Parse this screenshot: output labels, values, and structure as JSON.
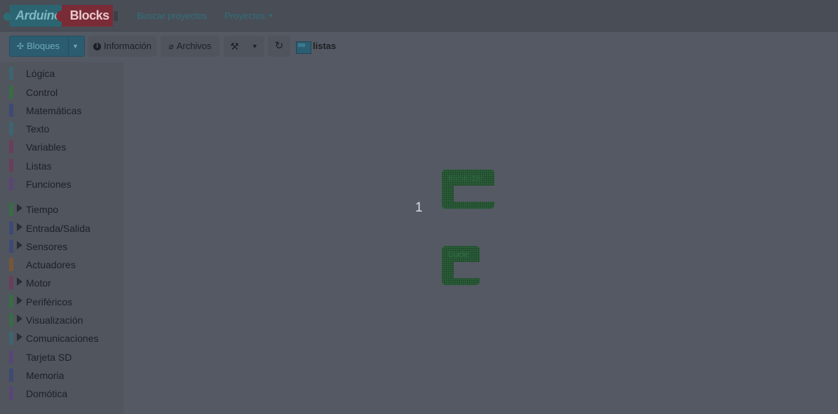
{
  "app": {
    "logo_left": "Arduino",
    "logo_right": "Blocks"
  },
  "nav": {
    "search_projects": "Buscar proyectos",
    "projects": "Proyectos"
  },
  "toolbar": {
    "blocks": "Bloques",
    "info": "Información",
    "files": "Archivos",
    "project_name": "listas"
  },
  "sidebar": {
    "categories": [
      {
        "label": "Lógica",
        "color": "#3d6470",
        "expandable": false
      },
      {
        "label": "Control",
        "color": "#386b46",
        "expandable": false
      },
      {
        "label": "Matemáticas",
        "color": "#3f4a74",
        "expandable": false
      },
      {
        "label": "Texto",
        "color": "#3d6470",
        "expandable": false
      },
      {
        "label": "Variables",
        "color": "#6b3d5e",
        "expandable": false
      },
      {
        "label": "Listas",
        "color": "#6b3d5e",
        "expandable": false
      },
      {
        "label": "Funciones",
        "color": "#5a4577",
        "expandable": false
      },
      {
        "label": "Tiempo",
        "color": "#386b46",
        "expandable": true
      },
      {
        "label": "Entrada/Salida",
        "color": "#3f4a74",
        "expandable": true
      },
      {
        "label": "Sensores",
        "color": "#3f4a74",
        "expandable": true
      },
      {
        "label": "Actuadores",
        "color": "#755738",
        "expandable": false
      },
      {
        "label": "Motor",
        "color": "#6b3d5e",
        "expandable": true
      },
      {
        "label": "Periféricos",
        "color": "#386b46",
        "expandable": true
      },
      {
        "label": "Visualización",
        "color": "#386b46",
        "expandable": true
      },
      {
        "label": "Comunicaciones",
        "color": "#3d6470",
        "expandable": true
      },
      {
        "label": "Tarjeta SD",
        "color": "#5a4577",
        "expandable": false
      },
      {
        "label": "Memoria",
        "color": "#3f4a74",
        "expandable": false
      },
      {
        "label": "Domótica",
        "color": "#5a4577",
        "expandable": false
      }
    ]
  },
  "workspace": {
    "block_count": "1",
    "blocks": [
      {
        "label": "Inicializar"
      },
      {
        "label": "Bucle"
      }
    ]
  }
}
